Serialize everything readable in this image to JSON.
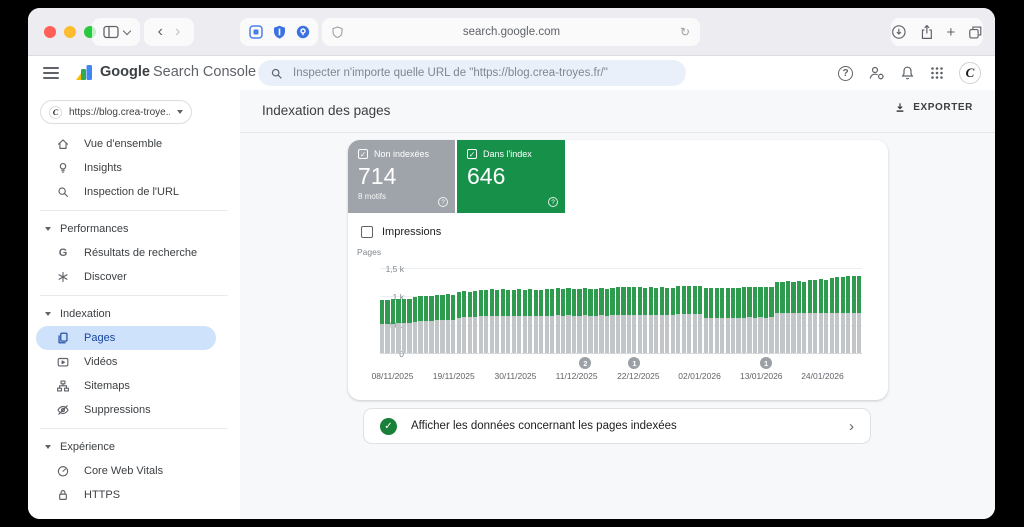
{
  "browser": {
    "address": "search.google.com",
    "toolbar_icons_left": [
      "sidebar-toggle",
      "chevron-down",
      "back",
      "forward"
    ],
    "extension_icons": [
      "code-extension",
      "shield-extension",
      "password-extension"
    ],
    "address_icons": [
      "privacy-shield",
      "reload"
    ],
    "toolbar_icons_right": [
      "downloads",
      "share",
      "new-tab",
      "tab-overview"
    ],
    "glyphs": {
      "back": "‹",
      "forward": "›",
      "reload": "↻",
      "new_tab": "+"
    }
  },
  "app_header": {
    "brand": "Google",
    "brand_suffix": "Search Console",
    "search": {
      "icon": "search-icon",
      "placeholder": "Inspecter n'importe quelle URL de \"https://blog.crea-troyes.fr/\""
    },
    "action_icons": [
      "help",
      "manage-users",
      "notifications",
      "google-apps"
    ],
    "avatar_letter": "C"
  },
  "sidebar": {
    "property": {
      "label": "https://blog.crea-troye...",
      "icon": "site-logo"
    },
    "groups": [
      {
        "items": [
          {
            "icon": "home",
            "label": "Vue d'ensemble"
          },
          {
            "icon": "bulb",
            "label": "Insights"
          },
          {
            "icon": "search",
            "label": "Inspection de l'URL"
          }
        ]
      },
      {
        "header": "Performances",
        "items": [
          {
            "icon": "g",
            "label": "Résultats de recherche"
          },
          {
            "icon": "asterisk",
            "label": "Discover"
          }
        ]
      },
      {
        "header": "Indexation",
        "items": [
          {
            "icon": "pages",
            "label": "Pages",
            "selected": true
          },
          {
            "icon": "video",
            "label": "Vidéos"
          },
          {
            "icon": "sitemap",
            "label": "Sitemaps"
          },
          {
            "icon": "eyeoff",
            "label": "Suppressions"
          }
        ]
      },
      {
        "header": "Expérience",
        "items": [
          {
            "icon": "gauge",
            "label": "Core Web Vitals"
          },
          {
            "icon": "lock",
            "label": "HTTPS"
          }
        ]
      }
    ]
  },
  "main": {
    "title": "Indexation des pages",
    "export_label": "EXPORTER"
  },
  "summary_cards": [
    {
      "id": "not-indexed",
      "label": "Non indexées",
      "value": "714",
      "sub": "8 motifs",
      "color": "#9fa4aa",
      "checked": true
    },
    {
      "id": "indexed",
      "label": "Dans l'index",
      "value": "646",
      "sub": "",
      "color": "#17914a",
      "checked": true
    }
  ],
  "impressions_label": "Impressions",
  "chart_data": {
    "type": "bar",
    "stacked": true,
    "ylabel": "Pages",
    "ylim": [
      0,
      1500
    ],
    "grid": true,
    "yticks": [
      {
        "label": "1,5 k",
        "value": 1500
      },
      {
        "label": "1 k",
        "value": 1000
      },
      {
        "label": "500",
        "value": 500
      },
      {
        "label": "0",
        "value": 0
      }
    ],
    "xticks": [
      {
        "label": "08/11/2025",
        "pos": 2.6
      },
      {
        "label": "19/11/2025",
        "pos": 15.3
      },
      {
        "label": "30/11/2025",
        "pos": 28.1
      },
      {
        "label": "11/12/2025",
        "pos": 40.8
      },
      {
        "label": "22/12/2025",
        "pos": 53.6
      },
      {
        "label": "02/01/2026",
        "pos": 66.3
      },
      {
        "label": "13/01/2026",
        "pos": 79.1
      },
      {
        "label": "24/01/2026",
        "pos": 91.8
      }
    ],
    "series": [
      {
        "name": "Non indexées",
        "color": "#c3c6c9",
        "values": [
          510,
          515,
          520,
          525,
          525,
          530,
          555,
          560,
          560,
          565,
          580,
          580,
          585,
          585,
          625,
          630,
          630,
          635,
          650,
          650,
          655,
          650,
          655,
          650,
          650,
          655,
          650,
          655,
          650,
          650,
          660,
          660,
          665,
          660,
          665,
          660,
          660,
          665,
          660,
          660,
          665,
          660,
          675,
          675,
          680,
          675,
          680,
          675,
          675,
          680,
          675,
          680,
          675,
          675,
          690,
          690,
          695,
          690,
          690,
          620,
          620,
          625,
          620,
          625,
          620,
          620,
          625,
          630,
          625,
          630,
          625,
          630,
          700,
          700,
          705,
          700,
          705,
          700,
          705,
          705,
          710,
          705,
          710,
          710,
          712,
          714,
          714,
          714
        ]
      },
      {
        "name": "Dans l'index",
        "color": "#2e9b4e",
        "values": [
          420,
          425,
          425,
          430,
          435,
          430,
          440,
          440,
          445,
          440,
          445,
          445,
          450,
          445,
          455,
          460,
          455,
          460,
          465,
          465,
          470,
          465,
          470,
          465,
          465,
          470,
          465,
          470,
          465,
          465,
          475,
          475,
          480,
          475,
          480,
          475,
          475,
          480,
          475,
          475,
          480,
          475,
          480,
          485,
          480,
          485,
          480,
          485,
          480,
          485,
          480,
          485,
          480,
          480,
          490,
          490,
          495,
          490,
          490,
          525,
          525,
          530,
          525,
          530,
          525,
          525,
          535,
          540,
          535,
          540,
          535,
          540,
          560,
          560,
          565,
          560,
          565,
          560,
          590,
          590,
          595,
          590,
          620,
          625,
          630,
          640,
          645,
          646
        ]
      }
    ],
    "annotations": [
      {
        "label": "2",
        "pos": 42.6
      },
      {
        "label": "1",
        "pos": 52.8
      },
      {
        "label": "1",
        "pos": 80.1
      }
    ]
  },
  "footer_bar": {
    "icon": "check-circle",
    "label": "Afficher les données concernant les pages indexées",
    "chevron": "›"
  }
}
